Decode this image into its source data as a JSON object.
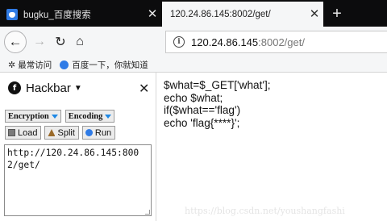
{
  "tabs": [
    {
      "title": "bugku_百度搜索",
      "icon": "baidu-paw-icon",
      "active": false
    },
    {
      "title": "120.24.86.145:8002/get/",
      "icon": "",
      "active": true
    }
  ],
  "nav": {
    "url_host": "120.24.86.145",
    "url_rest": ":8002/get/"
  },
  "bookmarks": [
    {
      "label": "最常访问",
      "icon": "gear-icon"
    },
    {
      "label": "百度一下，你就知道",
      "icon": "baidu-paw-icon"
    }
  ],
  "hackbar": {
    "title": "Hackbar",
    "buttons_top": [
      "Encryption",
      "Encoding"
    ],
    "buttons_actions": [
      "Load",
      "Split",
      "Run"
    ],
    "url_value": "http://120.24.86.145:8002/get/"
  },
  "page": {
    "lines": [
      "$what=$_GET['what'];",
      "echo $what;",
      "if($what=='flag')",
      "echo 'flag{****}';"
    ]
  },
  "watermark": "https://blog.csdn.net/youshangfashi",
  "colors": {
    "tab_strip": "#0c0c0d",
    "toolbar": "#f5f6f7",
    "accent_blue": "#1e88e5"
  }
}
